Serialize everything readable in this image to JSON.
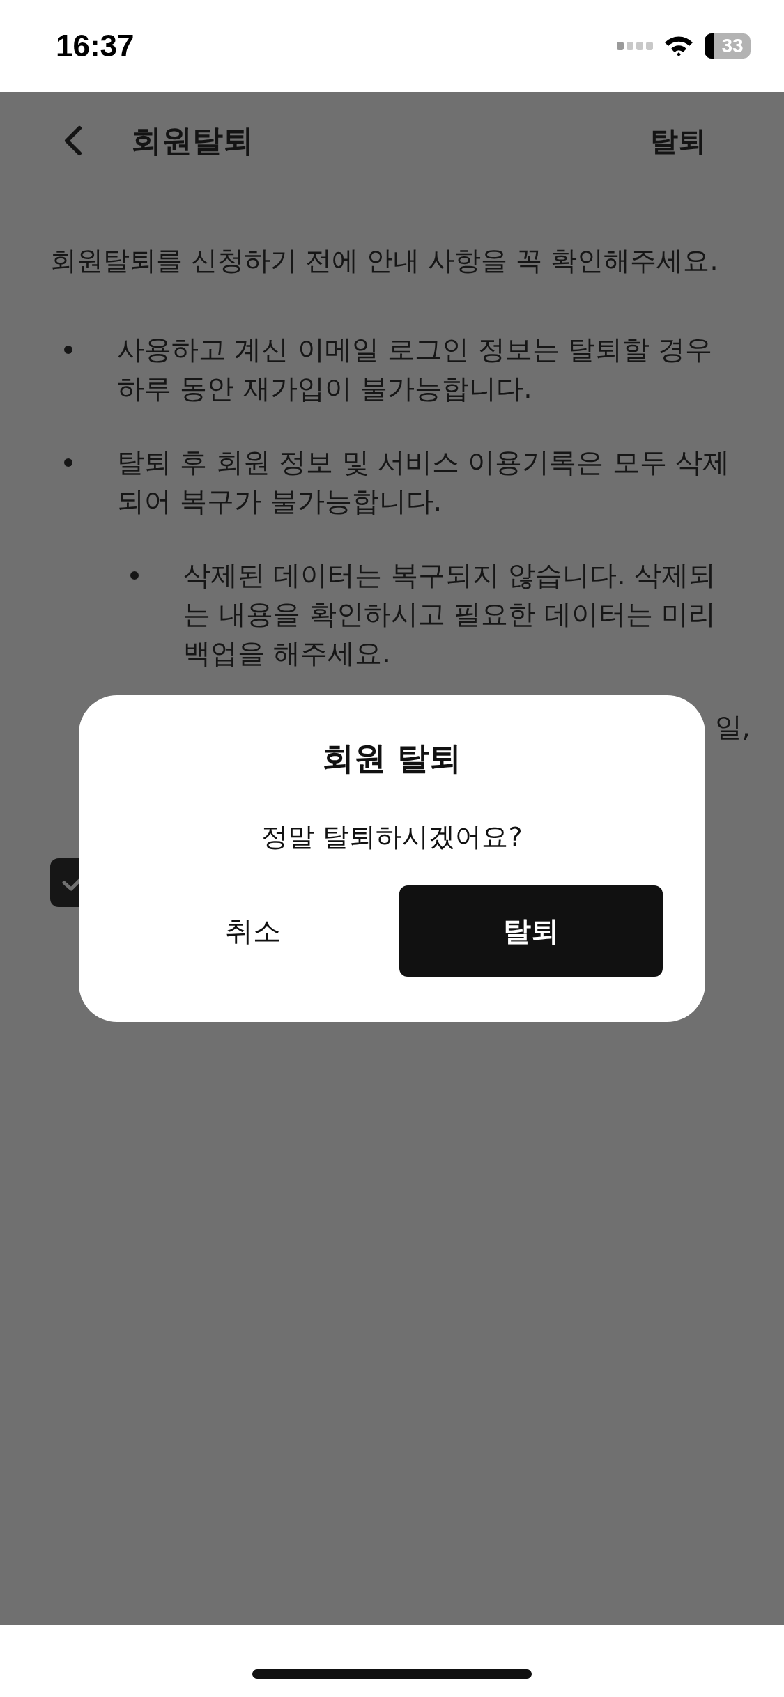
{
  "status_bar": {
    "time": "16:37",
    "battery": "33"
  },
  "header": {
    "title": "회원탈퇴",
    "action": "탈퇴"
  },
  "intro": "회원탈퇴를 신청하기 전에 안내 사항을 꼭 확인해주세요.",
  "notices": [
    {
      "text": "사용하고 계신 이메일 로그인 정보는 탈퇴할 경우 하루 동안 재가입이 불가능합니다."
    },
    {
      "text": "탈퇴 후 회원 정보 및 서비스 이용기록은 모두 삭제되어 복구가 불가능합니다.",
      "children": [
        {
          "text": "삭제된 데이터는 복구되지 않습니다. 삭제되는 내용을 확인하시고 필요한 데이터는 미리 백업을 해주세요."
        }
      ]
    },
    {
      "text": "일,"
    }
  ],
  "agree_checkbox": {
    "checked": true
  },
  "dialog": {
    "title": "회원 탈퇴",
    "message": "정말 탈퇴하시겠어요?",
    "buttons": [
      {
        "label": "취소",
        "kind": "text"
      },
      {
        "label": "탈퇴",
        "kind": "primary"
      }
    ]
  }
}
